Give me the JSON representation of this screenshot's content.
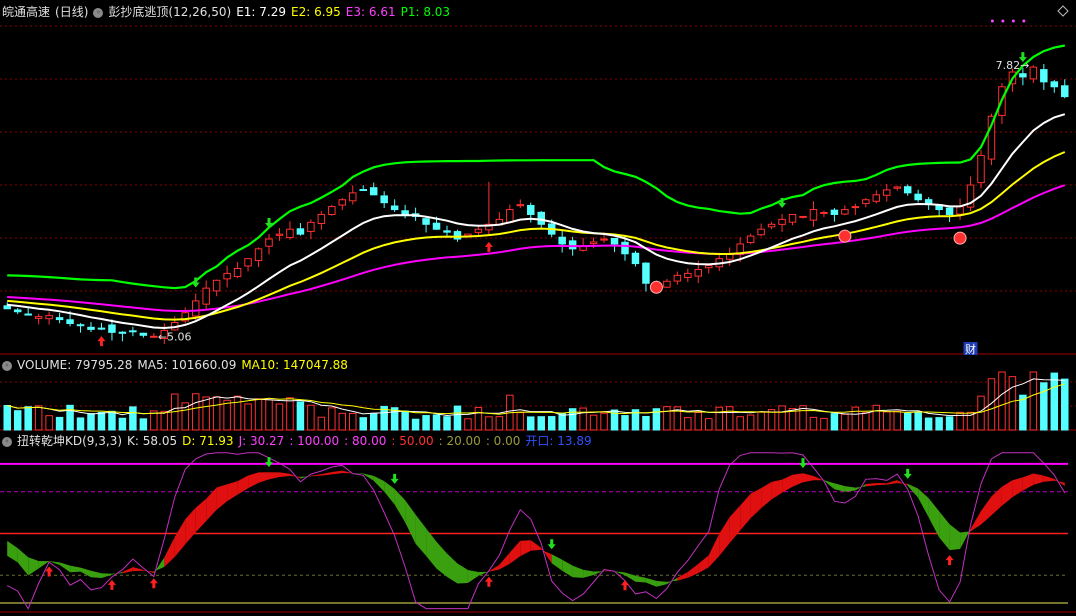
{
  "header_main": {
    "stock_name": "皖通高速",
    "period": "(日线)",
    "indicator": "彭抄底逃顶(12,26,50)",
    "e1": "E1: 7.29",
    "e2": "E2: 6.95",
    "e3": "E3: 6.61",
    "p1": "P1: 8.03"
  },
  "header_volume": {
    "volume": "VOLUME: 79795.28",
    "ma5": "MA5: 101660.09",
    "ma10": "MA10: 147047.88"
  },
  "header_kd": {
    "title": "扭转乾坤KD(9,3,3)",
    "k": "K: 58.05",
    "d": "D: 71.93",
    "j": "J: 30.27",
    "l100": ": 100.00",
    "l80": ": 80.00",
    "l50": ": 50.00",
    "l20": ": 20.00",
    "l0": ": 0.00",
    "open": "开口: 13.89"
  },
  "annotations": {
    "low_label": "5.06",
    "high_label": "7.82",
    "fin_badge": "财"
  },
  "colors": {
    "up": "#ff3030",
    "down": "#54ffff",
    "e1": "#ffffff",
    "e2": "#ffff00",
    "e3": "#ff00ff",
    "p1": "#00ff00",
    "grid": "#8a0000"
  },
  "chart_data": [
    {
      "type": "candlestick",
      "title": "彭抄底逃顶(12,26,50)",
      "ylim": [
        4.9,
        8.3
      ],
      "price_seed": [
        5.34,
        5.31,
        5.28,
        5.26,
        5.27,
        5.23,
        5.19,
        5.17,
        5.13,
        5.14,
        5.1,
        5.09,
        5.11,
        5.07,
        5.06,
        5.12,
        5.2,
        5.3,
        5.42,
        5.55,
        5.63,
        5.7,
        5.75,
        5.85,
        5.95,
        6.05,
        6.1,
        6.15,
        6.1,
        6.22,
        6.3,
        6.38,
        6.45,
        6.52,
        6.55,
        6.5,
        6.42,
        6.35,
        6.3,
        6.28,
        6.2,
        6.15,
        6.12,
        6.05,
        6.1,
        6.15,
        6.2,
        6.25,
        6.35,
        6.4,
        6.3,
        6.2,
        6.1,
        6.0,
        5.95,
        5.98,
        6.02,
        6.05,
        6.0,
        5.9,
        5.8,
        5.6,
        5.55,
        5.62,
        5.68,
        5.7,
        5.74,
        5.78,
        5.85,
        5.9,
        6.0,
        6.08,
        6.15,
        6.2,
        6.25,
        6.3,
        6.28,
        6.35,
        6.32,
        6.3,
        6.35,
        6.38,
        6.45,
        6.5,
        6.55,
        6.58,
        6.52,
        6.45,
        6.4,
        6.35,
        6.3,
        6.38,
        6.6,
        6.9,
        7.3,
        7.6,
        7.75,
        7.7,
        7.8,
        7.65,
        7.6,
        7.5
      ],
      "series": [
        {
          "name": "E1",
          "values": [
            7.29
          ]
        },
        {
          "name": "E2",
          "values": [
            6.95
          ]
        },
        {
          "name": "E3",
          "values": [
            6.61
          ]
        },
        {
          "name": "P1",
          "values": [
            8.03
          ]
        }
      ],
      "low": 5.06,
      "high": 7.82
    },
    {
      "type": "bar",
      "title": "VOLUME",
      "series": [
        {
          "name": "VOLUME",
          "values": [
            79795.28
          ]
        },
        {
          "name": "MA5",
          "values": [
            101660.09
          ]
        },
        {
          "name": "MA10",
          "values": [
            147047.88
          ]
        }
      ]
    },
    {
      "type": "line",
      "title": "扭转乾坤KD(9,3,3)",
      "ylim": [
        -5,
        110
      ],
      "levels": [
        100,
        80,
        50,
        20,
        0
      ],
      "series": [
        {
          "name": "K",
          "values": [
            58.05
          ]
        },
        {
          "name": "D",
          "values": [
            71.93
          ]
        },
        {
          "name": "J",
          "values": [
            30.27
          ]
        }
      ],
      "open": 13.89
    }
  ]
}
